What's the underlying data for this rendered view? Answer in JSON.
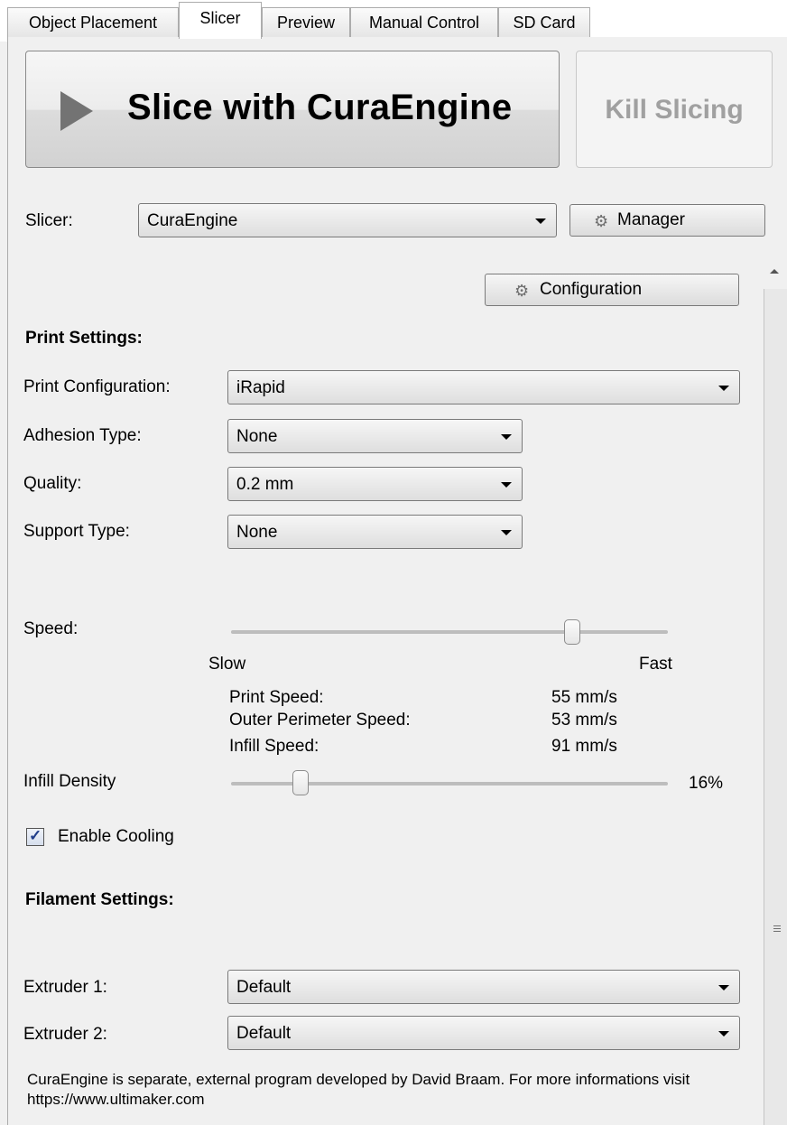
{
  "tabs": [
    {
      "label": "Object Placement"
    },
    {
      "label": "Slicer"
    },
    {
      "label": "Preview"
    },
    {
      "label": "Manual Control"
    },
    {
      "label": "SD Card"
    }
  ],
  "actions": {
    "slice_label": "Slice with CuraEngine",
    "kill_label": "Kill Slicing"
  },
  "slicer_row": {
    "label": "Slicer:",
    "value": "CuraEngine",
    "manager_label": "Manager",
    "configuration_label": "Configuration"
  },
  "print_settings": {
    "heading": "Print Settings:",
    "print_configuration": {
      "label": "Print Configuration:",
      "value": "iRapid"
    },
    "adhesion_type": {
      "label": "Adhesion Type:",
      "value": "None"
    },
    "quality": {
      "label": "Quality:",
      "value": "0.2 mm"
    },
    "support_type": {
      "label": "Support Type:",
      "value": "None"
    },
    "speed": {
      "label": "Speed:",
      "slow_label": "Slow",
      "fast_label": "Fast",
      "level_fraction": 0.78,
      "details": [
        {
          "label": "Print Speed:",
          "value": "55 mm/s"
        },
        {
          "label": "Outer Perimeter Speed:",
          "value": "53 mm/s"
        },
        {
          "label": "Infill Speed:",
          "value": "91 mm/s"
        }
      ]
    },
    "infill_density": {
      "label": "Infill Density",
      "value": "16%",
      "level_fraction": 0.16
    },
    "cooling": {
      "label": "Enable Cooling",
      "checked": true
    }
  },
  "filament_settings": {
    "heading": "Filament Settings:",
    "extruder1": {
      "label": "Extruder 1:",
      "value": "Default"
    },
    "extruder2": {
      "label": "Extruder 2:",
      "value": "Default"
    }
  },
  "footer_text": "CuraEngine is separate, external program developed by David Braam. For more informations visit https://www.ultimaker.com",
  "icons": {
    "play": "play-icon",
    "manager": "gears-icon",
    "configuration": "gear-icon",
    "check": "check-icon"
  },
  "colors": {
    "window_bg": "#f0f0f0",
    "disabled_text": "#a0a0a0",
    "slider_track": "#bdbdbd",
    "checkbox_tick": "#1f3c8a"
  }
}
